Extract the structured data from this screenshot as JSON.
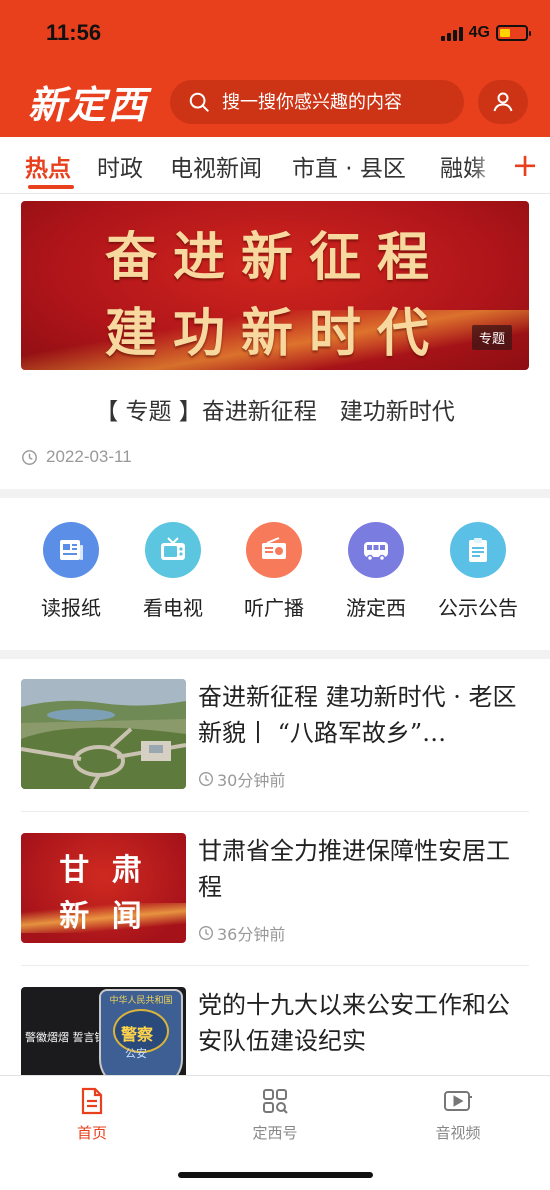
{
  "status_bar": {
    "time": "11:56",
    "network": "4G",
    "battery_percent": 40
  },
  "header": {
    "logo": "新定西",
    "search_placeholder": "搜一搜你感兴趣的内容",
    "accent_color": "#e8401d"
  },
  "tabs": [
    {
      "label": "热点",
      "active": true
    },
    {
      "label": "时政"
    },
    {
      "label": "电视新闻"
    },
    {
      "label": "市直 · 县区"
    },
    {
      "label": "融媒"
    }
  ],
  "banner": {
    "line1": "奋进新征程",
    "line2": "建功新时代",
    "tag": "专题"
  },
  "feature": {
    "title": "【 专题 】奋进新征程　建功新时代",
    "date": "2022-03-11"
  },
  "quick_access": [
    {
      "label": "读报纸",
      "icon": "newspaper-icon",
      "color": "#5b8ee6"
    },
    {
      "label": "看电视",
      "icon": "tv-icon",
      "color": "#5cc6e0"
    },
    {
      "label": "听广播",
      "icon": "radio-icon",
      "color": "#f77b5a"
    },
    {
      "label": "游定西",
      "icon": "bus-icon",
      "color": "#7b7ce0"
    },
    {
      "label": "公示公告",
      "icon": "clipboard-icon",
      "color": "#5bc0e6"
    }
  ],
  "news": [
    {
      "title": "奋进新征程  建功新时代 · 老区新貌丨 “八路军故乡”…",
      "time": "30分钟前",
      "thumb": "aerial-landscape"
    },
    {
      "title": "甘肃省全力推进保障性安居工程",
      "time": "36分钟前",
      "thumb": "gansu-news",
      "thumb_text": [
        "甘 肃",
        "新 闻"
      ]
    },
    {
      "title": "党的十九大以来公安工作和公安队伍建设纪实",
      "time": "",
      "thumb": "police-badge",
      "thumb_text": [
        "警徽熠熠  誓言铮铮",
        "中华人民共和国",
        "警察",
        "公安"
      ]
    }
  ],
  "bottom_nav": [
    {
      "label": "首页",
      "icon": "document-icon",
      "active": true
    },
    {
      "label": "定西号",
      "icon": "grid-search-icon"
    },
    {
      "label": "音视频",
      "icon": "video-play-icon"
    }
  ]
}
